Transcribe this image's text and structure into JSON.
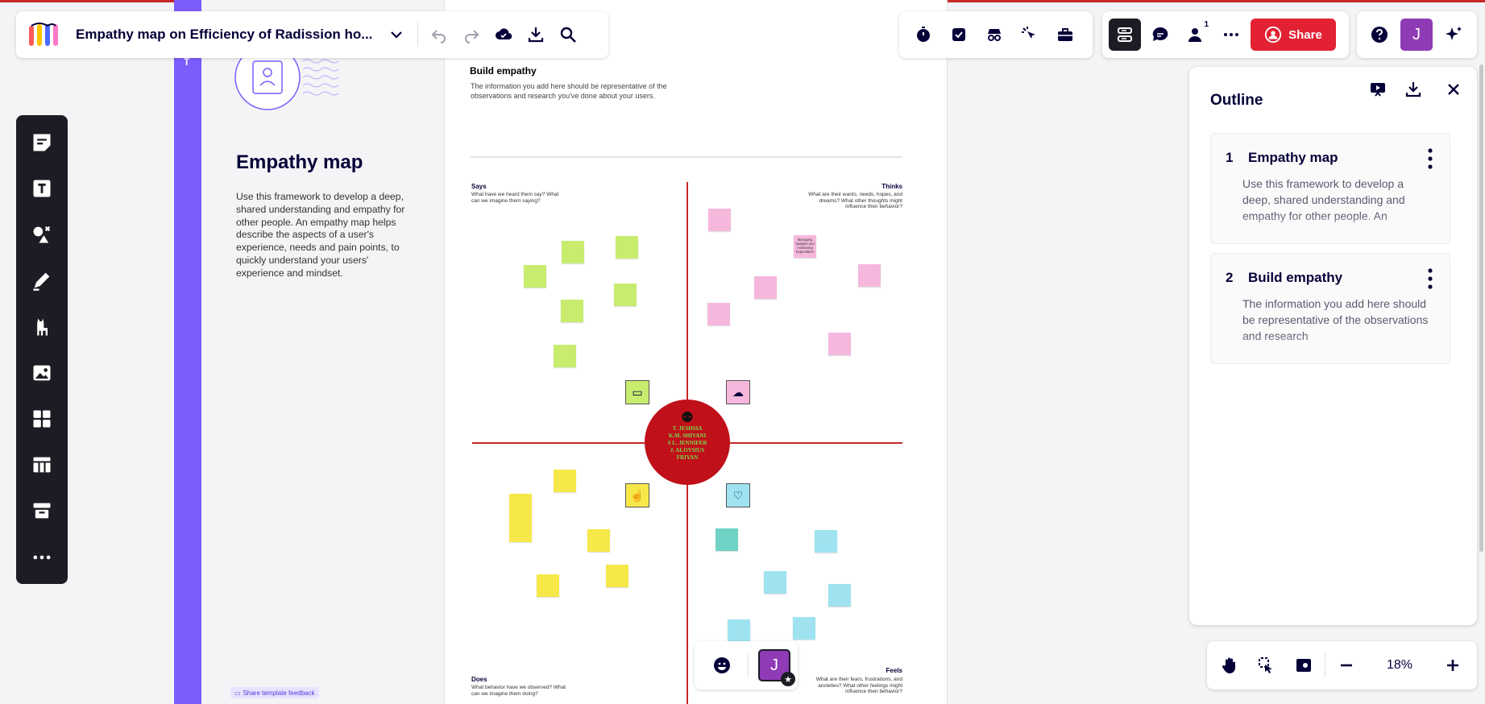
{
  "header": {
    "board_title": "Empathy map on Efficiency of Radission ho...",
    "share_label": "Share",
    "collaborator_count": "1",
    "avatar_initial": "J"
  },
  "template_panel": {
    "tab_letter": "T",
    "title": "Empathy map",
    "description": "Use this framework to develop a deep, shared understanding and empathy for other people. An empathy map helps describe the aspects of a user's experience, needs and pain points, to quickly understand your users' experience and mindset.",
    "feedback_label": "Share template feedback"
  },
  "board": {
    "section_title": "Build empathy",
    "section_desc": "The information you add here should be representative of the observations and research you've done about your users.",
    "says_title": "Says",
    "says_q": "What have we heard them say? What can we imagine them saying?",
    "thinks_title": "Thinks",
    "thinks_q": "What are their wants, needs, hopes, and dreams? What other thoughts might influence their behavior?",
    "does_title": "Does",
    "does_q": "What behavior have we observed? What can we imagine them doing?",
    "feels_title": "Feels",
    "feels_q": "What are their fears, frustrations, and anxieties? What other feelings might influence their behavior?",
    "center_names": [
      "T. JESHSIA",
      "K.M. SHIVANI",
      "S L. JENNIFER",
      "J. ALOYSIUS",
      "FRIYAN"
    ],
    "thinks_notes": [
      "Managing budgets and monitoring Expenditure"
    ]
  },
  "outline": {
    "title": "Outline",
    "items": [
      {
        "num": "1",
        "title": "Empathy map",
        "desc": "Use this framework to develop a deep, shared understanding and empathy for other people. An"
      },
      {
        "num": "2",
        "title": "Build empathy",
        "desc": "The information you add here should be representative of the observations and research"
      }
    ]
  },
  "zoom": {
    "level": "18%"
  },
  "bottom_bar": {
    "avatar_initial": "J"
  },
  "colors": {
    "accent": "#e22233",
    "purple": "#7c5cfc",
    "center_circle": "#c0101a",
    "toolbar_dark": "#1c1c24",
    "avatar": "#8e3bb5"
  }
}
